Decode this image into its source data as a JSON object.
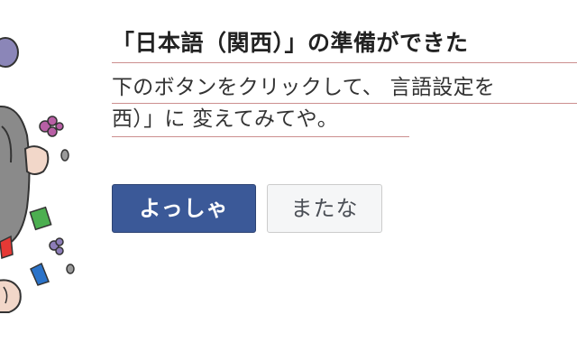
{
  "dialog": {
    "title": "「日本語（関西）」の準備ができた",
    "description_line1": "下のボタンをクリックして、 言語設定を",
    "description_line2": "西）」に 変えてみてや。"
  },
  "actions": {
    "confirm_label": "よっしゃ",
    "cancel_label": "またな"
  },
  "colors": {
    "primary_button": "#3b5998",
    "secondary_button": "#f5f6f7",
    "underline": "#cc8f8f"
  },
  "illustration": {
    "icon": "celebrating-mascot-icon"
  }
}
